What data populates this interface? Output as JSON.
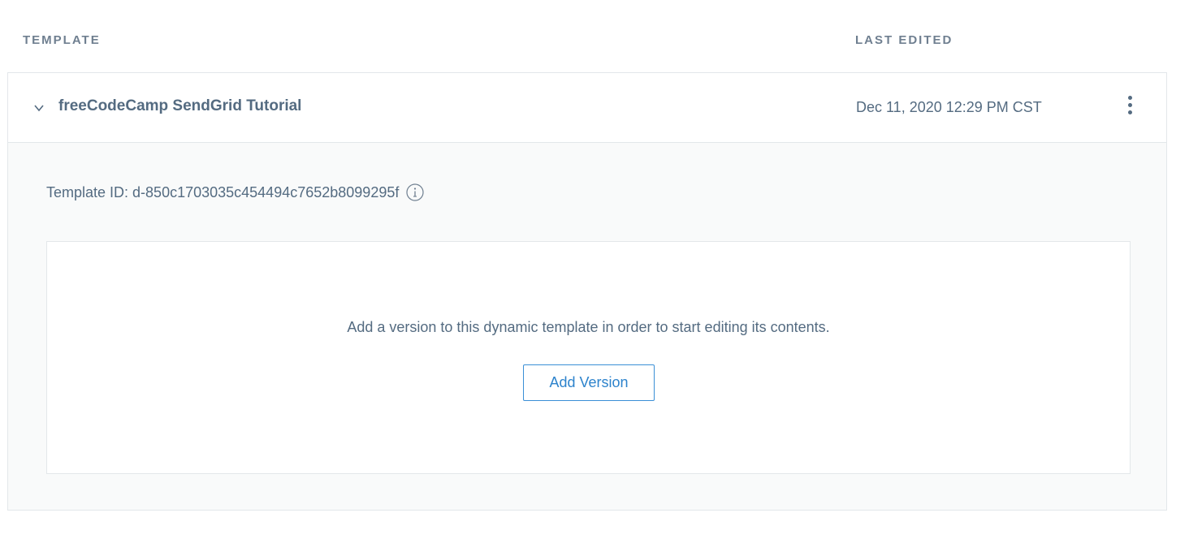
{
  "table_header": {
    "template_label": "TEMPLATE",
    "last_edited_label": "LAST EDITED"
  },
  "template": {
    "name": "freeCodeCamp SendGrid Tutorial",
    "last_edited": "Dec 11, 2020 12:29 PM CST",
    "expanded": true,
    "id_text": "Template ID: d-850c1703035c454494c7652b8099295f"
  },
  "empty_state": {
    "message": "Add a version to this dynamic template in order to start editing its contents.",
    "button_label": "Add Version"
  },
  "icons": {
    "expand": "chevron-down-icon",
    "menu": "kebab-menu-icon",
    "info": "info-icon"
  },
  "colors": {
    "text": "#546b81",
    "header_text": "#6f7f90",
    "accent": "#3a8fd6",
    "panel_bg": "#f9fafa",
    "border": "#e3e7ea"
  }
}
